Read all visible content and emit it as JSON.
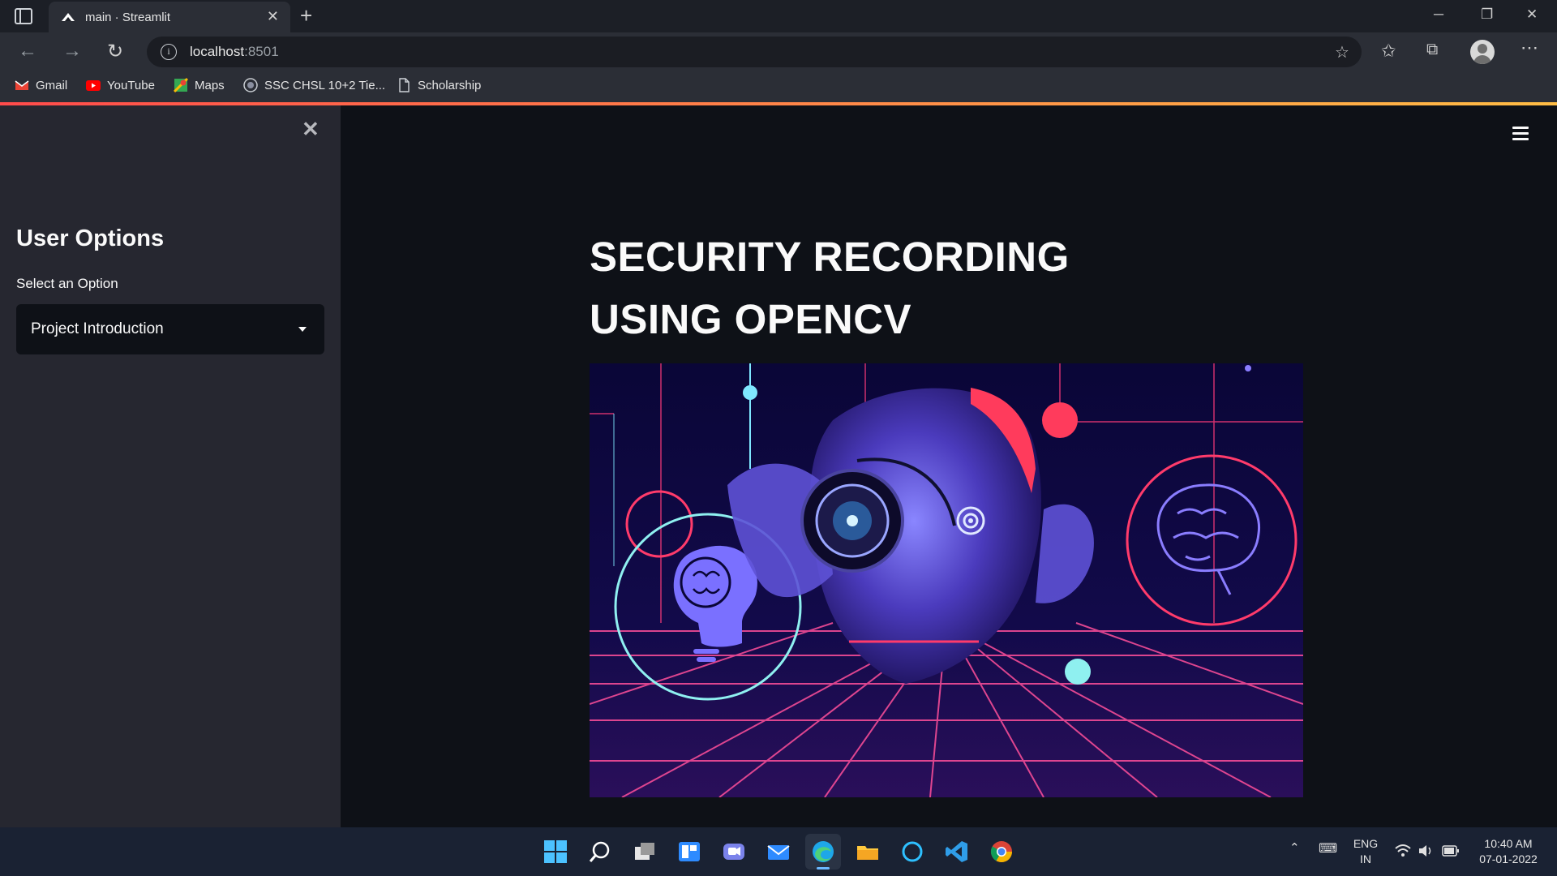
{
  "browser": {
    "tab_title": "main · Streamlit",
    "address_host": "localhost",
    "address_port": ":8501",
    "bookmarks": [
      {
        "label": "Gmail",
        "icon": "gmail-icon",
        "color": "#ea4335"
      },
      {
        "label": "YouTube",
        "icon": "youtube-icon",
        "color": "#ff0000"
      },
      {
        "label": "Maps",
        "icon": "maps-icon",
        "color": "#34a853"
      },
      {
        "label": "SSC CHSL 10+2 Tie...",
        "icon": "ssc-icon",
        "color": "#9aa0a6"
      },
      {
        "label": "Scholarship",
        "icon": "page-icon",
        "color": "#cfd3d8"
      }
    ]
  },
  "sidebar": {
    "title": "User Options",
    "select_label": "Select an Option",
    "select_value": "Project Introduction"
  },
  "main": {
    "title": "SECURITY RECORDING USING OPENCV",
    "hero_image": "ai-face-surveillance-illustration"
  },
  "taskbar": {
    "apps": [
      "start-icon",
      "search-icon",
      "task-view-icon",
      "widgets-icon",
      "teams-chat-icon",
      "mail-icon",
      "edge-icon",
      "file-explorer-icon",
      "cortana-icon",
      "vscode-icon",
      "chrome-icon"
    ],
    "lang_line1": "ENG",
    "lang_line2": "IN",
    "time": "10:40 AM",
    "date": "07-01-2022"
  },
  "colors": {
    "accent": "#ff4b4b",
    "background": "#0e1117",
    "sidebar": "#262730"
  }
}
